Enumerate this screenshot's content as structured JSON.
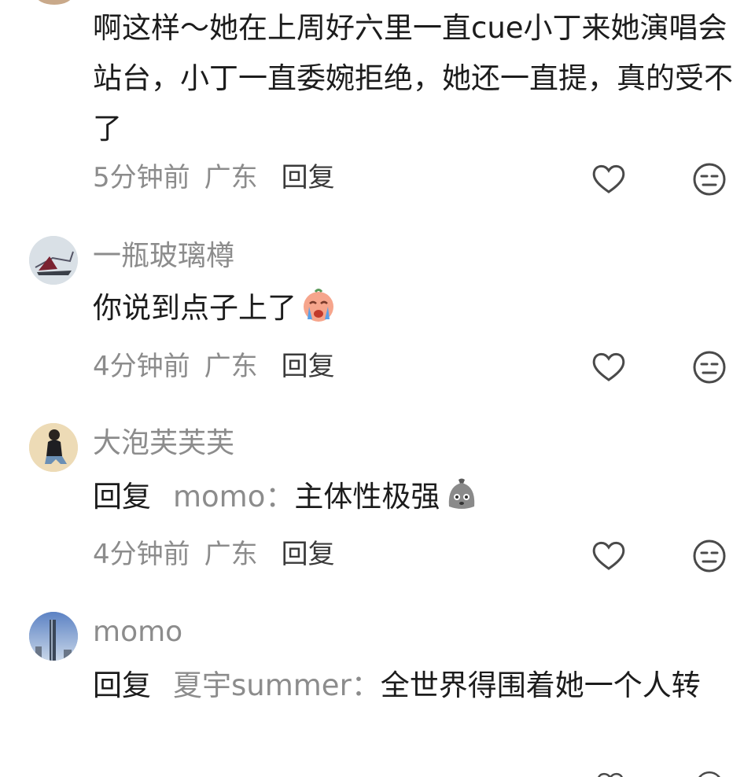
{
  "comments": [
    {
      "text": "啊这样～她在上周好六里一直cue小丁来她演唱会站台，小丁一直委婉拒绝，她还一直提，真的受不了",
      "time": "5分钟前",
      "location": "广东",
      "reply_label": "回复"
    },
    {
      "username": "一瓶玻璃樽",
      "text": "你说到点子上了",
      "emoji": "crying-face-emoji",
      "time": "4分钟前",
      "location": "广东",
      "reply_label": "回复"
    },
    {
      "username": "大泡芙芙芙",
      "reply_prefix": "回复",
      "reply_target": "momo：",
      "text": "主体性极强",
      "emoji": "grey-sack-emoji",
      "time": "4分钟前",
      "location": "广东",
      "reply_label": "回复"
    },
    {
      "username": "momo",
      "reply_prefix": "回复",
      "reply_target": "夏宇summer：",
      "text": "全世界得围着她一个人转"
    }
  ],
  "icons": {
    "like": "heart-outline-icon",
    "dislike": "meh-face-icon"
  },
  "colors": {
    "text": "#1c1c1c",
    "muted": "#8c8c8c",
    "background": "#ffffff"
  }
}
